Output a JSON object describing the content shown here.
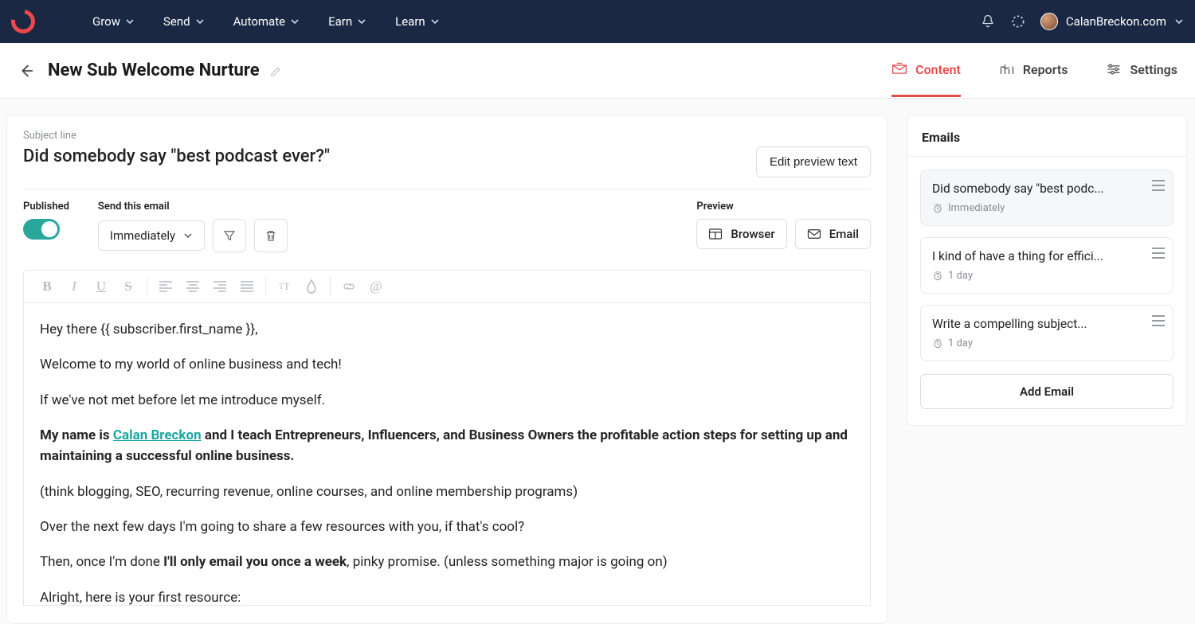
{
  "nav": {
    "items": [
      "Grow",
      "Send",
      "Automate",
      "Earn",
      "Learn"
    ],
    "account": "CalanBreckon.com"
  },
  "sequence": {
    "title": "New Sub Welcome Nurture",
    "tabs": {
      "content": "Content",
      "reports": "Reports",
      "settings": "Settings"
    }
  },
  "editor": {
    "subject_label": "Subject line",
    "subject": "Did somebody say \"best podcast ever?\"",
    "edit_preview": "Edit preview text",
    "published_label": "Published",
    "send_label": "Send this email",
    "timing": "Immediately",
    "preview_label": "Preview",
    "preview_browser": "Browser",
    "preview_email": "Email"
  },
  "body": {
    "p1": "Hey there {{ subscriber.first_name }},",
    "p2": "Welcome to my world of online business and tech!",
    "p3": "If we've not met before let me introduce myself.",
    "p4_pre": "My name is ",
    "p4_link": "Calan Breckon",
    "p4_post": " and I teach Entrepreneurs, Influencers, and Business Owners the profitable action steps for setting up and maintaining a successful online business.",
    "p5": "(think blogging, SEO, recurring revenue, online courses, and online membership programs)",
    "p6": "Over the next few days I'm going to share a few resources with you, if that's cool?",
    "p7_pre": "Then, once I'm done ",
    "p7_bold": "I'll only email you once a week",
    "p7_post": ", pinky promise. (unless something major is going on)",
    "p8": "Alright, here is your first resource:"
  },
  "sidebar": {
    "title": "Emails",
    "emails": [
      {
        "title": "Did somebody say \"best podc...",
        "timing": "Immediately"
      },
      {
        "title": "I kind of have a thing for effici...",
        "timing": "1 day"
      },
      {
        "title": "Write a compelling subject...",
        "timing": "1 day"
      }
    ],
    "add": "Add Email"
  }
}
